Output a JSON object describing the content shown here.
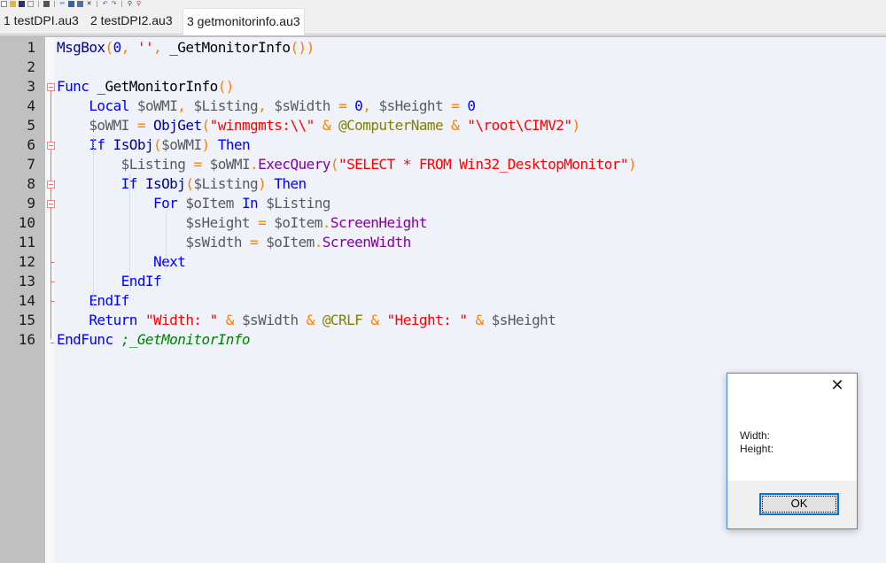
{
  "toolbar": {
    "icons": [
      "new-file-icon",
      "open-folder-icon",
      "save-icon",
      "close-file-icon",
      "print-icon",
      "cut-icon",
      "copy-icon",
      "paste-icon",
      "delete-icon",
      "undo-icon",
      "redo-icon",
      "find-icon",
      "replace-icon"
    ]
  },
  "tabs": [
    {
      "label": "1 testDPI.au3",
      "active": false
    },
    {
      "label": "2 testDPI2.au3",
      "active": false
    },
    {
      "label": "3 getmonitorinfo.au3",
      "active": true
    }
  ],
  "editor": {
    "line_numbers": [
      "1",
      "2",
      "3",
      "4",
      "5",
      "6",
      "7",
      "8",
      "9",
      "10",
      "11",
      "12",
      "13",
      "14",
      "15",
      "16"
    ],
    "lines": [
      "MsgBox(0, '', _GetMonitorInfo())",
      "",
      "Func _GetMonitorInfo()",
      "    Local $oWMI, $Listing, $sWidth = 0, $sHeight = 0",
      "    $oWMI = ObjGet(\"winmgmts:\\\\\" & @ComputerName & \"\\root\\CIMV2\")",
      "    If IsObj($oWMI) Then",
      "        $Listing = $oWMI.ExecQuery(\"SELECT * FROM Win32_DesktopMonitor\")",
      "        If IsObj($Listing) Then",
      "            For $oItem In $Listing",
      "                $sHeight = $oItem.ScreenHeight",
      "                $sWidth = $oItem.ScreenWidth",
      "            Next",
      "        EndIf",
      "    EndIf",
      "    Return \"Width: \" & $sWidth & @CRLF & \"Height: \" & $sHeight",
      "EndFunc ;_GetMonitorInfo"
    ],
    "tokens": {
      "l1": [
        "MsgBox",
        "(",
        "0",
        ", ",
        "''",
        ", ",
        "_GetMonitorInfo",
        "()",
        ")"
      ],
      "l3": [
        "Func",
        " ",
        "_GetMonitorInfo",
        "()"
      ],
      "l4": [
        "    ",
        "Local",
        " ",
        "$oWMI",
        ", ",
        "$Listing",
        ", ",
        "$sWidth",
        " ",
        "=",
        " ",
        "0",
        ", ",
        "$sHeight",
        " ",
        "=",
        " ",
        "0"
      ],
      "l5": [
        "    ",
        "$oWMI",
        " ",
        "=",
        " ",
        "ObjGet",
        "(",
        "\"winmgmts:\\\\\"",
        " ",
        "&",
        " ",
        "@ComputerName",
        " ",
        "&",
        " ",
        "\"\\root\\CIMV2\"",
        ")"
      ],
      "l6": [
        "    ",
        "If",
        " ",
        "IsObj",
        "(",
        "$oWMI",
        ")",
        " ",
        "Then"
      ],
      "l7": [
        "        ",
        "$Listing",
        " ",
        "=",
        " ",
        "$oWMI",
        ".",
        "ExecQuery",
        "(",
        "\"SELECT * FROM Win32_DesktopMonitor\"",
        ")"
      ],
      "l8": [
        "        ",
        "If",
        " ",
        "IsObj",
        "(",
        "$Listing",
        ")",
        " ",
        "Then"
      ],
      "l9": [
        "            ",
        "For",
        " ",
        "$oItem",
        " ",
        "In",
        " ",
        "$Listing"
      ],
      "l10": [
        "                ",
        "$sHeight",
        " ",
        "=",
        " ",
        "$oItem",
        ".",
        "ScreenHeight"
      ],
      "l11": [
        "                ",
        "$sWidth",
        " ",
        "=",
        " ",
        "$oItem",
        ".",
        "ScreenWidth"
      ],
      "l12": [
        "            ",
        "Next"
      ],
      "l13": [
        "        ",
        "EndIf"
      ],
      "l14": [
        "    ",
        "EndIf"
      ],
      "l15": [
        "    ",
        "Return",
        " ",
        "\"Width: \"",
        " ",
        "&",
        " ",
        "$sWidth",
        " ",
        "&",
        " ",
        "@CRLF",
        " ",
        "&",
        " ",
        "\"Height: \"",
        " ",
        "&",
        " ",
        "$sHeight"
      ],
      "l16": [
        "EndFunc",
        " ",
        ";_GetMonitorInfo"
      ]
    }
  },
  "colors": {
    "keyword": "#0000ff",
    "string": "#ff0000",
    "operator": "#ff8000",
    "macro": "#808000",
    "property": "#8000a0",
    "comment": "#008000",
    "variable": "#5a5a5a",
    "dialog_accent": "#0078d7"
  },
  "msgbox": {
    "close_glyph": "✕",
    "message": "Width: \nHeight: ",
    "ok_label": "OK"
  }
}
